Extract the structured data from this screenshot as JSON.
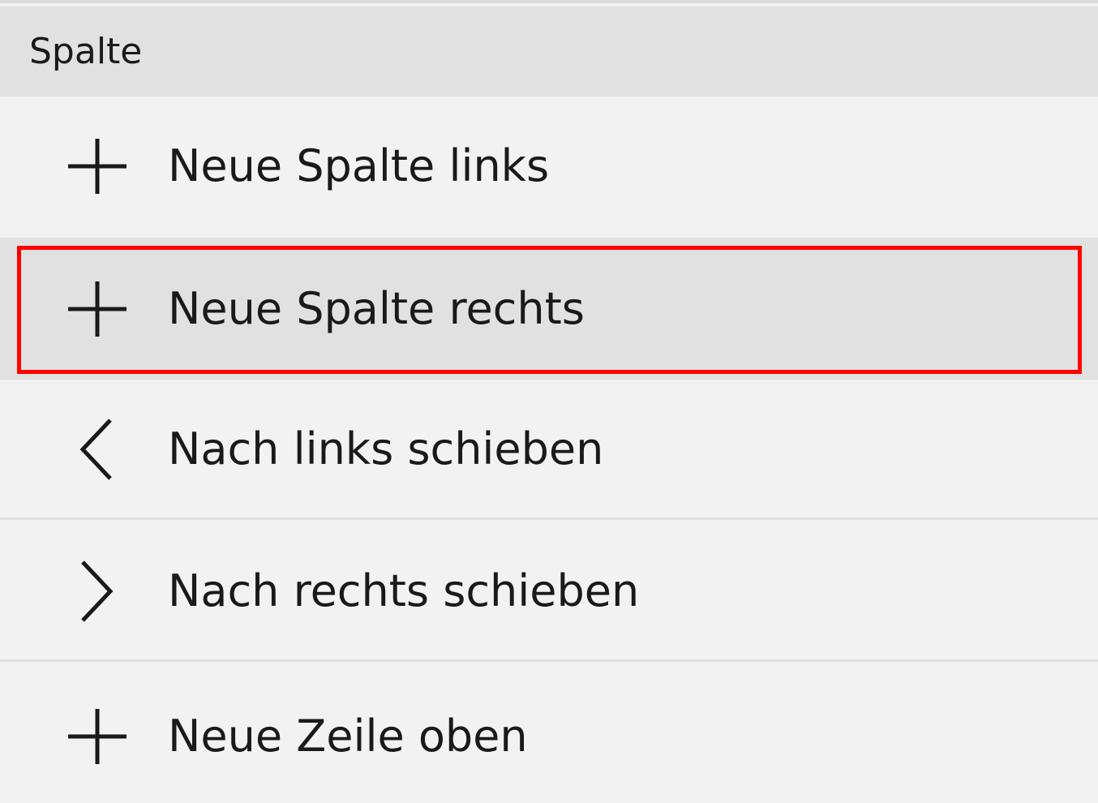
{
  "menu": {
    "section_title": "Spalte",
    "items": [
      {
        "label": "Neue Spalte links",
        "icon": "plus-icon",
        "selected": false
      },
      {
        "label": "Neue Spalte rechts",
        "icon": "plus-icon",
        "selected": true
      },
      {
        "label": "Nach links schieben",
        "icon": "chevron-left-icon",
        "selected": false
      },
      {
        "label": "Nach rechts schieben",
        "icon": "chevron-right-icon",
        "selected": false
      },
      {
        "label": "Neue Zeile oben",
        "icon": "plus-icon",
        "selected": false
      }
    ]
  },
  "colors": {
    "background": "#f2f2f2",
    "header_background": "#e1e1e1",
    "selected_background": "#e1e1e1",
    "highlight_border": "#ff0000",
    "text": "#1a1a1a"
  }
}
